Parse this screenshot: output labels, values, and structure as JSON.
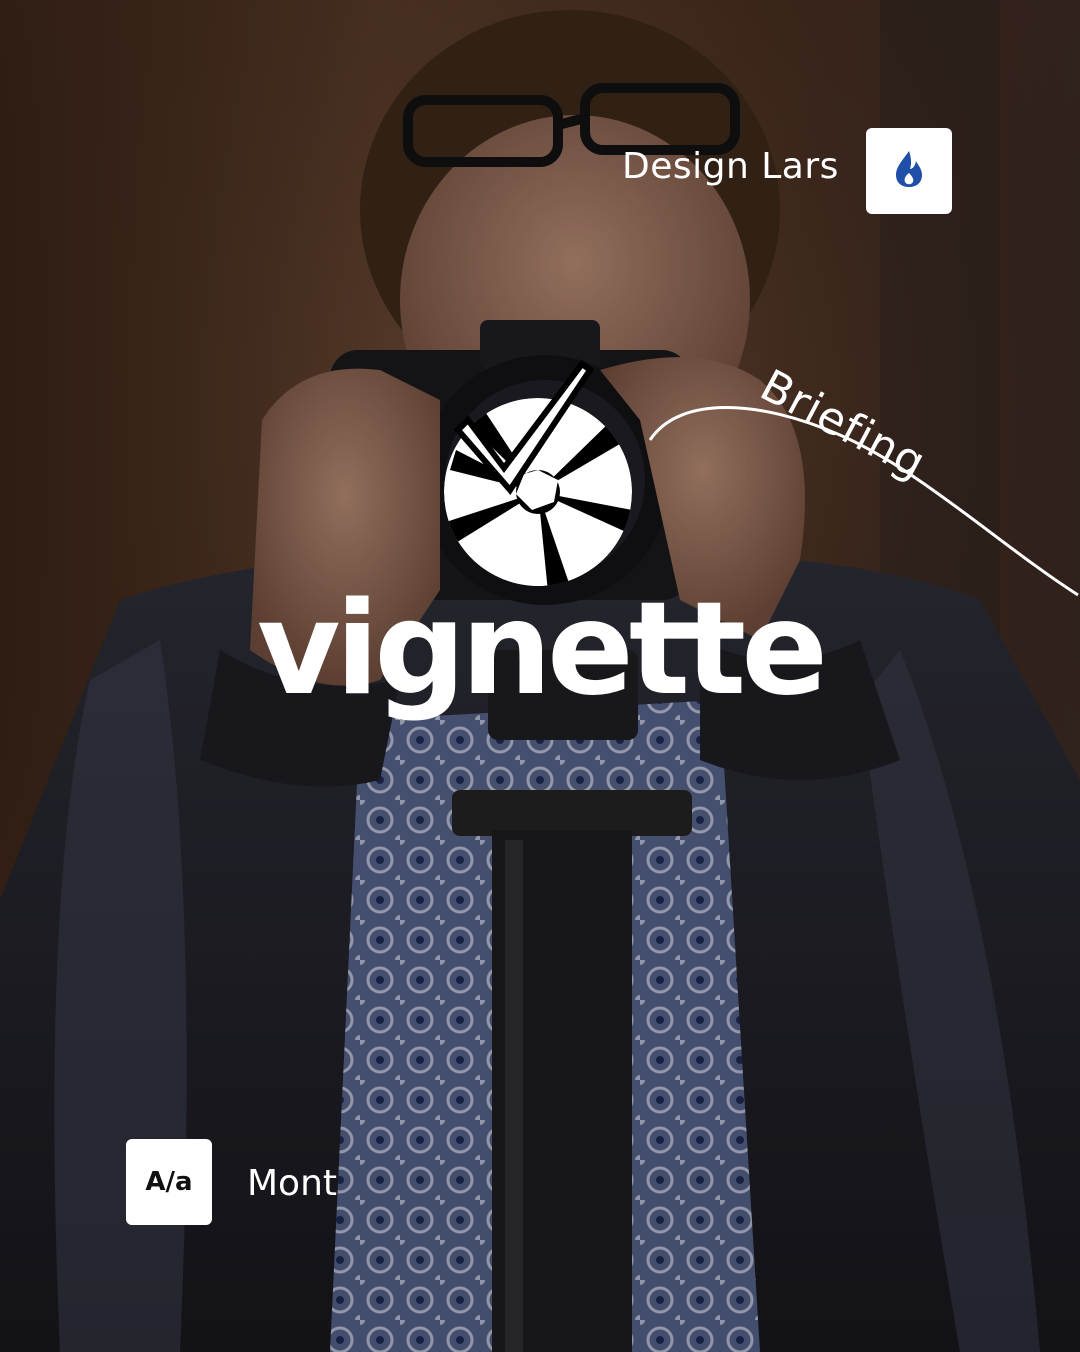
{
  "designer": {
    "label": "Design Lars",
    "badge_icon": "flame-icon",
    "badge_color": "#1f4fa8"
  },
  "annotation": {
    "label": "Briefing"
  },
  "logo": {
    "icon": "aperture-checkmark-icon",
    "wordmark": "vignette"
  },
  "font": {
    "badge_label": "A/a",
    "name": "Mont"
  },
  "colors": {
    "overlay_text": "#ffffff",
    "badge_background": "#ffffff"
  }
}
